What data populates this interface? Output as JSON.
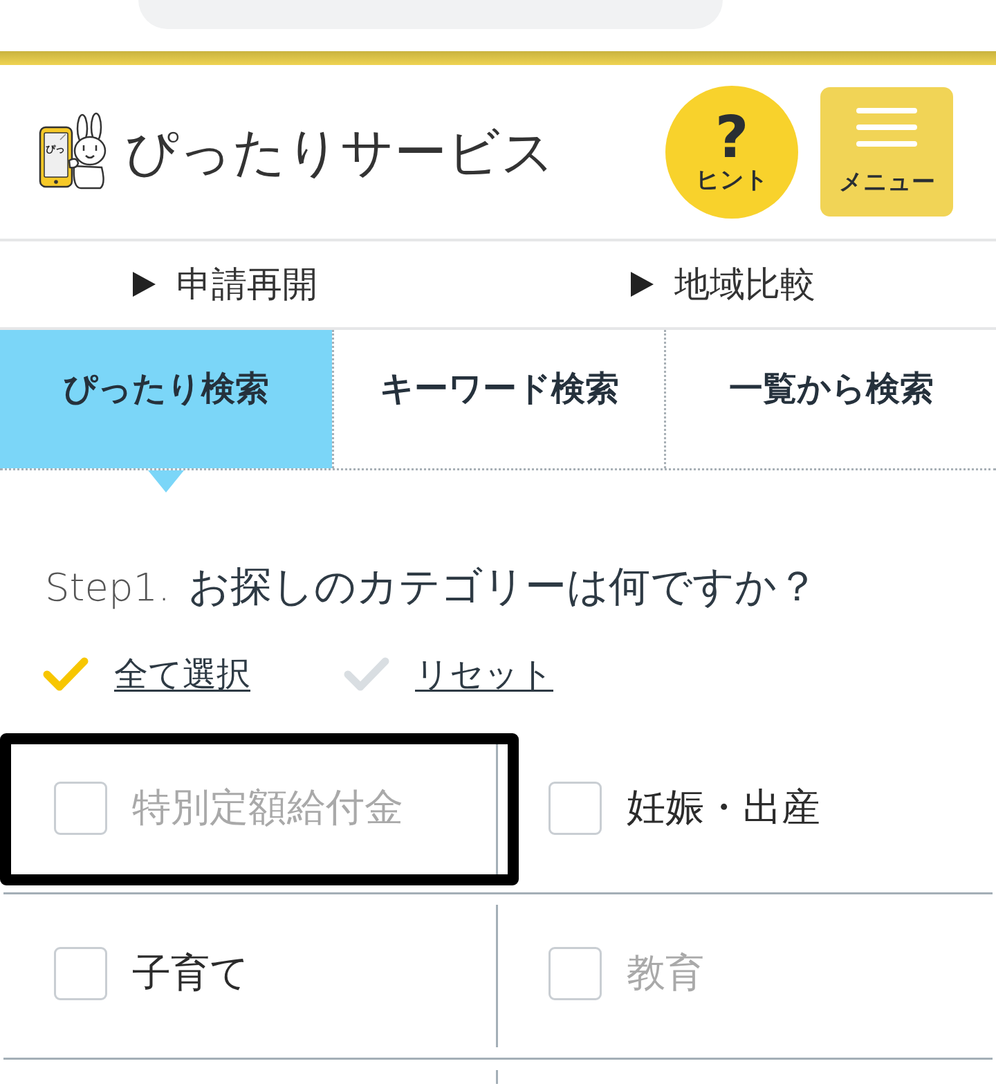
{
  "header": {
    "logo_text": "ぴっ",
    "title": "ぴったりサービス",
    "hint_button": {
      "symbol": "?",
      "label": "ヒント"
    },
    "menu_button": {
      "label": "メニュー"
    }
  },
  "nav_links": [
    {
      "label": "申請再開"
    },
    {
      "label": "地域比較"
    }
  ],
  "search_tabs": [
    {
      "label": "ぴったり検索",
      "selected": true
    },
    {
      "label": "キーワード検索",
      "selected": false
    },
    {
      "label": "一覧から検索",
      "selected": false
    }
  ],
  "step": {
    "label": "Step1.",
    "question": "お探しのカテゴリーは何ですか？"
  },
  "selection_actions": [
    {
      "kind": "select_all",
      "label": "全て選択"
    },
    {
      "kind": "reset",
      "label": "リセット"
    }
  ],
  "categories": [
    {
      "label": "特別定額給付金",
      "checked": false,
      "disabled": true,
      "highlighted": true
    },
    {
      "label": "妊娠・出産",
      "checked": false,
      "disabled": false,
      "highlighted": false
    },
    {
      "label": "子育て",
      "checked": false,
      "disabled": false,
      "highlighted": false
    },
    {
      "label": "教育",
      "checked": false,
      "disabled": true,
      "highlighted": false
    }
  ]
}
